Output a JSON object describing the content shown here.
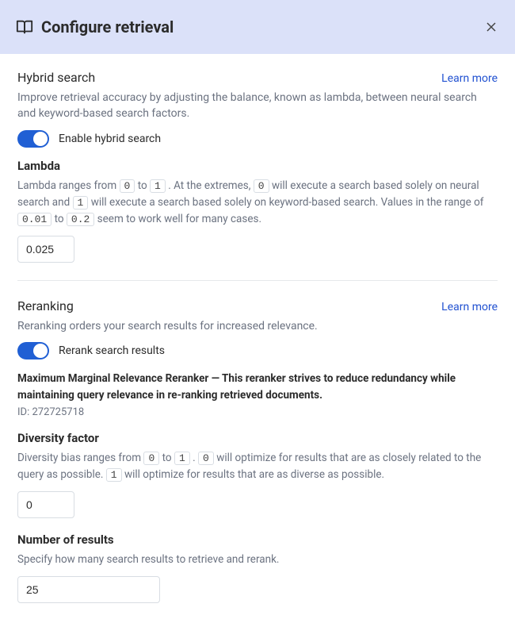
{
  "header": {
    "title": "Configure retrieval"
  },
  "hybrid": {
    "title": "Hybrid search",
    "learn_more": "Learn more",
    "desc": "Improve retrieval accuracy by adjusting the balance, known as lambda, between neural search and keyword-based search factors.",
    "toggle_label": "Enable hybrid search",
    "lambda_label": "Lambda",
    "lambda_help_1": "Lambda ranges from ",
    "lambda_help_2": " to ",
    "lambda_help_3": " . At the extremes, ",
    "lambda_help_4": " will execute a search based solely on neural search and ",
    "lambda_help_5": " will execute a search based solely on keyword-based search. Values in the range of ",
    "lambda_help_6": " to ",
    "lambda_help_7": " seem to work well for many cases.",
    "code_0a": "0",
    "code_1a": "1",
    "code_0b": "0",
    "code_1b": "1",
    "code_001": "0.01",
    "code_02": "0.2",
    "lambda_value": "0.025"
  },
  "reranking": {
    "title": "Reranking",
    "learn_more": "Learn more",
    "desc": "Reranking orders your search results for increased relevance.",
    "toggle_label": "Rerank search results",
    "reranker_name": "Maximum Marginal Relevance Reranker",
    "dash": " — ",
    "reranker_desc": "This reranker strives to reduce redundancy while maintaining query relevance in re-ranking retrieved documents.",
    "reranker_id_label": "ID: ",
    "reranker_id": "272725718",
    "diversity_label": "Diversity factor",
    "diversity_help_1": "Diversity bias ranges from ",
    "diversity_help_2": " to ",
    "diversity_help_3": " . ",
    "diversity_help_4": " will optimize for results that are as closely related to the query as possible. ",
    "diversity_help_5": " will optimize for results that are as diverse as possible.",
    "div_code_0a": "0",
    "div_code_1a": "1",
    "div_code_0b": "0",
    "div_code_1b": "1",
    "diversity_value": "0",
    "num_results_label": "Number of results",
    "num_results_help": "Specify how many search results to retrieve and rerank.",
    "num_results_value": "25"
  }
}
